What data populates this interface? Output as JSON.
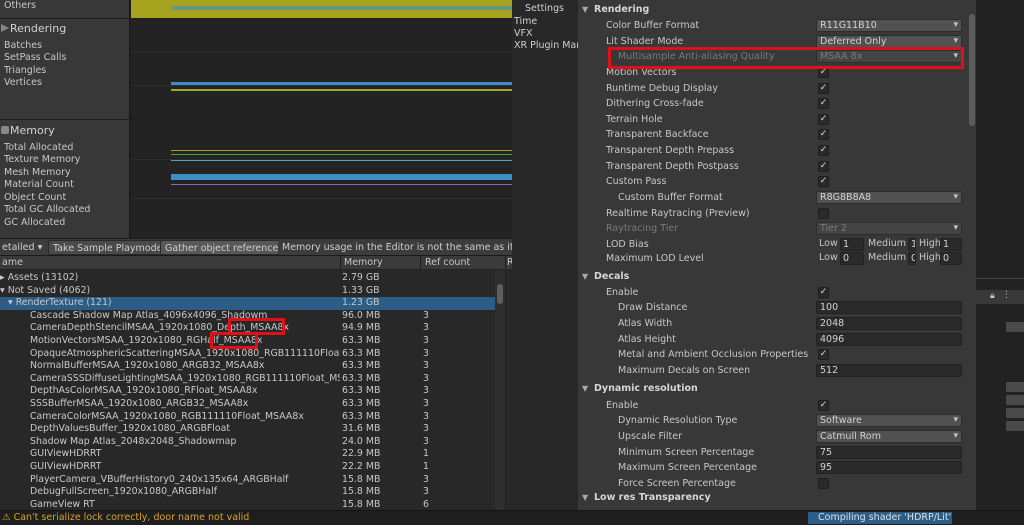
{
  "profiler": {
    "others_label": "Others",
    "rendering": {
      "title": "Rendering",
      "labels": [
        "Batches",
        "SetPass Calls",
        "Triangles",
        "Vertices"
      ]
    },
    "memory": {
      "title": "Memory",
      "labels": [
        "Total Allocated",
        "Texture Memory",
        "Mesh Memory",
        "Material Count",
        "Object Count",
        "Total GC Allocated",
        "GC Allocated"
      ]
    },
    "toolbar": {
      "view_mode": "etailed",
      "take_sample": "Take Sample Playmode",
      "gather_refs": "Gather object references",
      "note": "Memory usage in the Editor is not the same as it woul"
    },
    "columns": {
      "name": "ame",
      "memory": "Memory",
      "ref_count": "Ref count",
      "extra": "R"
    },
    "rows": [
      {
        "name": "Assets (13102)",
        "memory": "2.79 GB",
        "ref": ""
      },
      {
        "name": "Not Saved (4062)",
        "memory": "1.33 GB",
        "ref": ""
      },
      {
        "name": "RenderTexture (121)",
        "memory": "1.23 GB",
        "ref": ""
      },
      {
        "name": "Cascade Shadow Map Atlas_4096x4096_Shadowmap",
        "memory": "96.0 MB",
        "ref": "3"
      },
      {
        "name": "CameraDepthStencilMSAA_1920x1080_Depth_MSAA8x",
        "memory": "94.9 MB",
        "ref": "3"
      },
      {
        "name": "MotionVectorsMSAA_1920x1080_RGHalf_MSAA8x",
        "memory": "63.3 MB",
        "ref": "3"
      },
      {
        "name": "OpaqueAtmosphericScatteringMSAA_1920x1080_RGB111110Float_MSAA8x",
        "memory": "63.3 MB",
        "ref": "3"
      },
      {
        "name": "NormalBufferMSAA_1920x1080_ARGB32_MSAA8x",
        "memory": "63.3 MB",
        "ref": "3"
      },
      {
        "name": "CameraSSSDiffuseLightingMSAA_1920x1080_RGB111110Float_MSAA8x",
        "memory": "63.3 MB",
        "ref": "3"
      },
      {
        "name": "DepthAsColorMSAA_1920x1080_RFloat_MSAA8x",
        "memory": "63.3 MB",
        "ref": "3"
      },
      {
        "name": "SSSBufferMSAA_1920x1080_ARGB32_MSAA8x",
        "memory": "63.3 MB",
        "ref": "3"
      },
      {
        "name": "CameraColorMSAA_1920x1080_RGB111110Float_MSAA8x",
        "memory": "63.3 MB",
        "ref": "3"
      },
      {
        "name": "DepthValuesBuffer_1920x1080_ARGBFloat",
        "memory": "31.6 MB",
        "ref": "3"
      },
      {
        "name": "Shadow Map Atlas_2048x2048_Shadowmap",
        "memory": "24.0 MB",
        "ref": "3"
      },
      {
        "name": "GUIViewHDRRT",
        "memory": "22.9 MB",
        "ref": "1"
      },
      {
        "name": "GUIViewHDRRT",
        "memory": "22.2 MB",
        "ref": "1"
      },
      {
        "name": "PlayerCamera_VBufferHistory0_240x135x64_ARGBHalf",
        "memory": "15.8 MB",
        "ref": "3"
      },
      {
        "name": "DebugFullScreen_1920x1080_ARGBHalf",
        "memory": "15.8 MB",
        "ref": "3"
      },
      {
        "name": "GameView RT",
        "memory": "15.8 MB",
        "ref": "6"
      }
    ]
  },
  "settings_nav": [
    "Settings",
    "Time",
    "VFX",
    "XR Plugin Man"
  ],
  "inspector": {
    "rendering_header": "Rendering",
    "color_buffer_format": {
      "label": "Color Buffer Format",
      "value": "R11G11B10"
    },
    "lit_shader_mode": {
      "label": "Lit Shader Mode",
      "value": "Deferred Only"
    },
    "msaa_quality": {
      "label": "Multisample Anti-aliasing Quality",
      "value": "MSAA 8x"
    },
    "toggles": [
      "Motion Vectors",
      "Runtime Debug Display",
      "Dithering Cross-fade",
      "Terrain Hole",
      "Transparent Backface",
      "Transparent Depth Prepass",
      "Transparent Depth Postpass",
      "Custom Pass"
    ],
    "custom_buffer_format": {
      "label": "Custom Buffer Format",
      "value": "R8G8B8A8"
    },
    "realtime_raytracing": "Realtime Raytracing (Preview)",
    "raytracing_tier": {
      "label": "Raytracing Tier",
      "value": "Tier 2"
    },
    "lod_bias": {
      "label": "LOD Bias",
      "low_label": "Low",
      "low": "1",
      "medium_label": "Medium",
      "medium": "1",
      "high_label": "High",
      "high": "1"
    },
    "max_lod_level": {
      "label": "Maximum LOD Level",
      "low_label": "Low",
      "low": "0",
      "medium_label": "Medium",
      "medium": "0",
      "high_label": "High",
      "high": "0"
    },
    "decals": {
      "header": "Decals",
      "enable": "Enable",
      "draw_distance": {
        "label": "Draw Distance",
        "value": "100"
      },
      "atlas_width": {
        "label": "Atlas Width",
        "value": "2048"
      },
      "atlas_height": {
        "label": "Atlas Height",
        "value": "4096"
      },
      "metal_ao": "Metal and Ambient Occlusion Properties",
      "max_decals": {
        "label": "Maximum Decals on Screen",
        "value": "512"
      }
    },
    "dynamic_resolution": {
      "header": "Dynamic resolution",
      "enable": "Enable",
      "type": {
        "label": "Dynamic Resolution Type",
        "value": "Software"
      },
      "upscale": {
        "label": "Upscale Filter",
        "value": "Catmull Rom"
      },
      "min_pct": {
        "label": "Minimum Screen Percentage",
        "value": "75"
      },
      "max_pct": {
        "label": "Maximum Screen Percentage",
        "value": "95"
      },
      "force_pct": "Force Screen Percentage"
    },
    "low_res_header": "Low res Transparency"
  },
  "status": {
    "message": "Can't serialize lock correctly, door name not valid",
    "task": "Compiling shader 'HDRP/Lit'"
  },
  "colors": {
    "selection": "#2c5d87",
    "highlight_box": "#e0101b",
    "graph_yellow": "#a6a31f",
    "graph_blue": "#3d8fc2",
    "warning": "#d7a32a"
  }
}
